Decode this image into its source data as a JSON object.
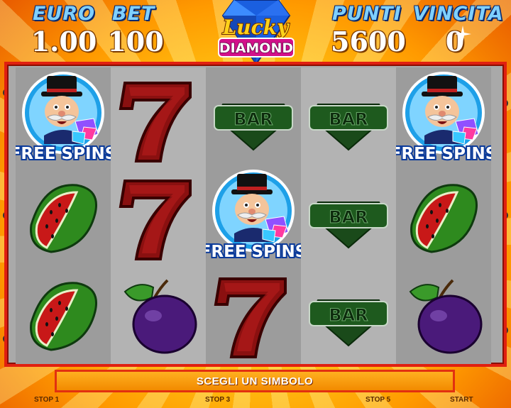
{
  "header": {
    "euro_label": "EURO",
    "euro_value": "1.00",
    "bet_label": "BET",
    "bet_value": "100",
    "punti_label": "PUNTI",
    "punti_value": "5600",
    "vincita_label": "VINCITA",
    "vincita_value": "0"
  },
  "logo": {
    "line1": "Lucky",
    "line2": "DIAMOND"
  },
  "symbols": {
    "free_spins_text": "FREE SPINS",
    "bar_text": "BAR"
  },
  "reels": [
    [
      "free-spins",
      "watermelon",
      "watermelon"
    ],
    [
      "seven",
      "seven",
      "plum"
    ],
    [
      "bar",
      "free-spins",
      "seven"
    ],
    [
      "bar",
      "bar",
      "bar"
    ],
    [
      "free-spins",
      "watermelon",
      "plum"
    ]
  ],
  "message": "SCEGLI UN SIMBOLO",
  "buttons": {
    "stop1": "STOP 1",
    "stop3": "STOP 3",
    "stop5": "STOP 5",
    "start": "START"
  }
}
